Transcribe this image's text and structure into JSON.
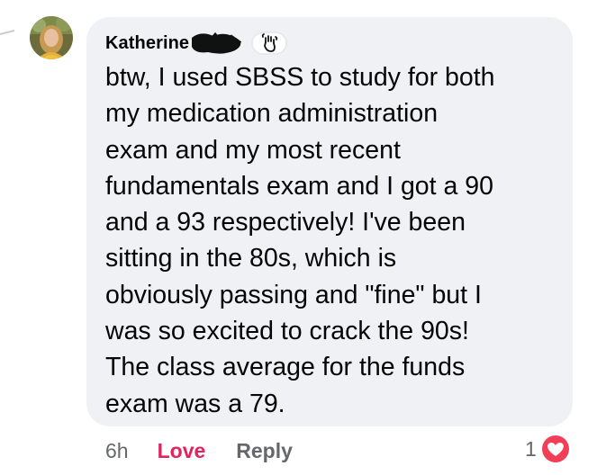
{
  "comment": {
    "author": "Katherine",
    "author_badge_icon": "waving-hand-icon",
    "text": "btw, I used SBSS to study for both\nmy medication administration\nexam and my most recent\nfundamentals exam and I got a 90\nand a 93 respectively! I've been\nsitting in the 80s, which is\nobviously passing and \"fine\" but I\nwas so excited to crack the 90s!\nThe class average for the funds\nexam was a 79.",
    "bubble_color": "#f0f1f5"
  },
  "actions": {
    "time": "6h",
    "love_label": "Love",
    "love_color": "#e0245e",
    "reply_label": "Reply"
  },
  "reaction": {
    "count": "1",
    "icon": "heart-reaction-icon",
    "color": "#f33e58"
  }
}
